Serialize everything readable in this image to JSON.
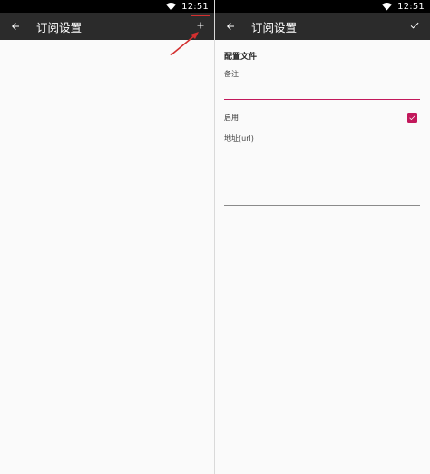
{
  "left_screen": {
    "status_time": "12:51",
    "title": "订阅设置",
    "back_icon": "arrow-left-icon",
    "add_icon": "plus-icon",
    "annotation_color": "#d32f2f"
  },
  "right_screen": {
    "status_time": "12:51",
    "title": "订阅设置",
    "back_icon": "arrow-left-icon",
    "confirm_icon": "check-icon",
    "section_title": "配置文件",
    "remark_label": "备注",
    "remark_value": "",
    "enable_label": "启用",
    "enable_checked": true,
    "url_label": "地址(url)",
    "url_value": ""
  },
  "colors": {
    "toolbar": "#2b2b2b",
    "accent": "#c2185b",
    "background": "#fafafa"
  }
}
